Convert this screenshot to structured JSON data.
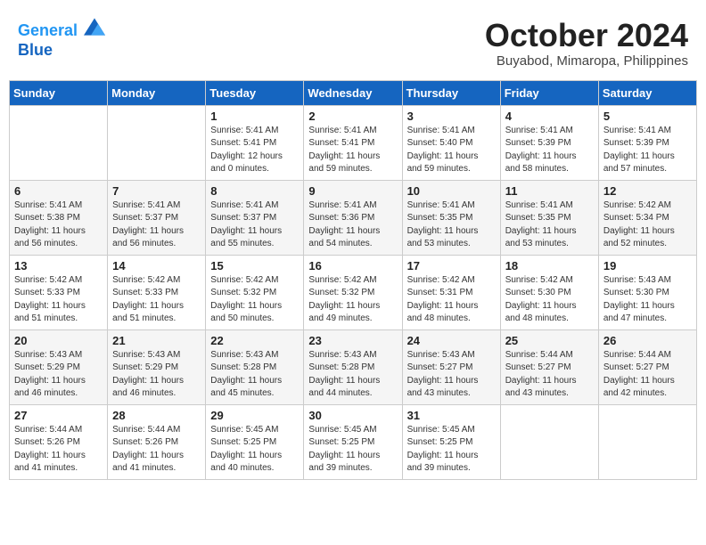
{
  "header": {
    "logo_line1": "General",
    "logo_line2": "Blue",
    "month_title": "October 2024",
    "location": "Buyabod, Mimaropa, Philippines"
  },
  "weekdays": [
    "Sunday",
    "Monday",
    "Tuesday",
    "Wednesday",
    "Thursday",
    "Friday",
    "Saturday"
  ],
  "weeks": [
    [
      {
        "day": "",
        "info": ""
      },
      {
        "day": "",
        "info": ""
      },
      {
        "day": "1",
        "info": "Sunrise: 5:41 AM\nSunset: 5:41 PM\nDaylight: 12 hours\nand 0 minutes."
      },
      {
        "day": "2",
        "info": "Sunrise: 5:41 AM\nSunset: 5:41 PM\nDaylight: 11 hours\nand 59 minutes."
      },
      {
        "day": "3",
        "info": "Sunrise: 5:41 AM\nSunset: 5:40 PM\nDaylight: 11 hours\nand 59 minutes."
      },
      {
        "day": "4",
        "info": "Sunrise: 5:41 AM\nSunset: 5:39 PM\nDaylight: 11 hours\nand 58 minutes."
      },
      {
        "day": "5",
        "info": "Sunrise: 5:41 AM\nSunset: 5:39 PM\nDaylight: 11 hours\nand 57 minutes."
      }
    ],
    [
      {
        "day": "6",
        "info": "Sunrise: 5:41 AM\nSunset: 5:38 PM\nDaylight: 11 hours\nand 56 minutes."
      },
      {
        "day": "7",
        "info": "Sunrise: 5:41 AM\nSunset: 5:37 PM\nDaylight: 11 hours\nand 56 minutes."
      },
      {
        "day": "8",
        "info": "Sunrise: 5:41 AM\nSunset: 5:37 PM\nDaylight: 11 hours\nand 55 minutes."
      },
      {
        "day": "9",
        "info": "Sunrise: 5:41 AM\nSunset: 5:36 PM\nDaylight: 11 hours\nand 54 minutes."
      },
      {
        "day": "10",
        "info": "Sunrise: 5:41 AM\nSunset: 5:35 PM\nDaylight: 11 hours\nand 53 minutes."
      },
      {
        "day": "11",
        "info": "Sunrise: 5:41 AM\nSunset: 5:35 PM\nDaylight: 11 hours\nand 53 minutes."
      },
      {
        "day": "12",
        "info": "Sunrise: 5:42 AM\nSunset: 5:34 PM\nDaylight: 11 hours\nand 52 minutes."
      }
    ],
    [
      {
        "day": "13",
        "info": "Sunrise: 5:42 AM\nSunset: 5:33 PM\nDaylight: 11 hours\nand 51 minutes."
      },
      {
        "day": "14",
        "info": "Sunrise: 5:42 AM\nSunset: 5:33 PM\nDaylight: 11 hours\nand 51 minutes."
      },
      {
        "day": "15",
        "info": "Sunrise: 5:42 AM\nSunset: 5:32 PM\nDaylight: 11 hours\nand 50 minutes."
      },
      {
        "day": "16",
        "info": "Sunrise: 5:42 AM\nSunset: 5:32 PM\nDaylight: 11 hours\nand 49 minutes."
      },
      {
        "day": "17",
        "info": "Sunrise: 5:42 AM\nSunset: 5:31 PM\nDaylight: 11 hours\nand 48 minutes."
      },
      {
        "day": "18",
        "info": "Sunrise: 5:42 AM\nSunset: 5:30 PM\nDaylight: 11 hours\nand 48 minutes."
      },
      {
        "day": "19",
        "info": "Sunrise: 5:43 AM\nSunset: 5:30 PM\nDaylight: 11 hours\nand 47 minutes."
      }
    ],
    [
      {
        "day": "20",
        "info": "Sunrise: 5:43 AM\nSunset: 5:29 PM\nDaylight: 11 hours\nand 46 minutes."
      },
      {
        "day": "21",
        "info": "Sunrise: 5:43 AM\nSunset: 5:29 PM\nDaylight: 11 hours\nand 46 minutes."
      },
      {
        "day": "22",
        "info": "Sunrise: 5:43 AM\nSunset: 5:28 PM\nDaylight: 11 hours\nand 45 minutes."
      },
      {
        "day": "23",
        "info": "Sunrise: 5:43 AM\nSunset: 5:28 PM\nDaylight: 11 hours\nand 44 minutes."
      },
      {
        "day": "24",
        "info": "Sunrise: 5:43 AM\nSunset: 5:27 PM\nDaylight: 11 hours\nand 43 minutes."
      },
      {
        "day": "25",
        "info": "Sunrise: 5:44 AM\nSunset: 5:27 PM\nDaylight: 11 hours\nand 43 minutes."
      },
      {
        "day": "26",
        "info": "Sunrise: 5:44 AM\nSunset: 5:27 PM\nDaylight: 11 hours\nand 42 minutes."
      }
    ],
    [
      {
        "day": "27",
        "info": "Sunrise: 5:44 AM\nSunset: 5:26 PM\nDaylight: 11 hours\nand 41 minutes."
      },
      {
        "day": "28",
        "info": "Sunrise: 5:44 AM\nSunset: 5:26 PM\nDaylight: 11 hours\nand 41 minutes."
      },
      {
        "day": "29",
        "info": "Sunrise: 5:45 AM\nSunset: 5:25 PM\nDaylight: 11 hours\nand 40 minutes."
      },
      {
        "day": "30",
        "info": "Sunrise: 5:45 AM\nSunset: 5:25 PM\nDaylight: 11 hours\nand 39 minutes."
      },
      {
        "day": "31",
        "info": "Sunrise: 5:45 AM\nSunset: 5:25 PM\nDaylight: 11 hours\nand 39 minutes."
      },
      {
        "day": "",
        "info": ""
      },
      {
        "day": "",
        "info": ""
      }
    ]
  ]
}
